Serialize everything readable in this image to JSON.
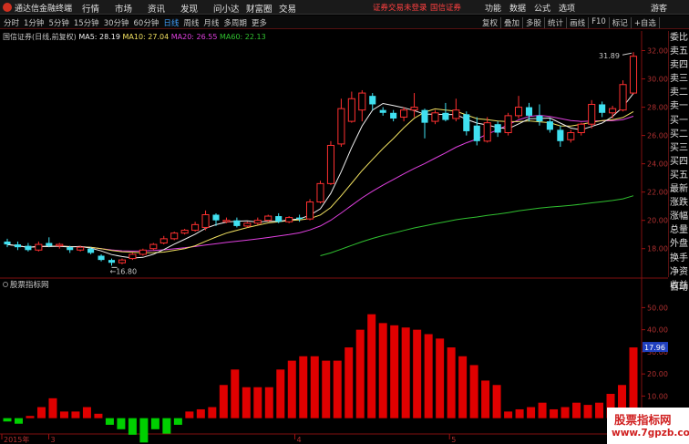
{
  "titlebar": {
    "app_name": "通达信金融终端",
    "menu": [
      "行情",
      "市场",
      "资讯",
      "发现",
      "问小达",
      "财富圈",
      "交易"
    ],
    "alert": "证券交易未登录",
    "broker": "国信证券",
    "right_menu": [
      "功能",
      "数据",
      "公式",
      "选项"
    ],
    "guest": "游客"
  },
  "toolbar": {
    "periods": [
      "分时",
      "1分钟",
      "5分钟",
      "15分钟",
      "30分钟",
      "60分钟",
      "日线",
      "周线",
      "月线",
      "多周期",
      "更多"
    ],
    "active_period": "日线",
    "tools": [
      "复权",
      "叠加",
      "多股",
      "统计",
      "画线",
      "F10",
      "标记",
      "+自选"
    ]
  },
  "info": {
    "stock": "国信证券(日线,前复权)",
    "ma5_label": "MA5: 28.19",
    "ma10_label": "MA10: 27.04",
    "ma20_label": "MA20: 26.55",
    "ma60_label": "MA60: 22.13"
  },
  "colors": {
    "up": "#ff3030",
    "down": "#40e0f0",
    "ma5": "#f0f0f0",
    "ma10": "#f0e060",
    "ma20": "#e040e0",
    "ma60": "#30c030",
    "bar_up": "#e00000",
    "bar_down": "#00d000",
    "value_box": "#2040c0"
  },
  "side_panel": [
    "委比",
    "卖五",
    "卖四",
    "卖三",
    "卖二",
    "卖一",
    "买一",
    "买二",
    "买三",
    "买四",
    "买五",
    "最新",
    "涨跌",
    "涨幅",
    "总量",
    "外盘",
    "换手",
    "净资",
    "收益"
  ],
  "dongli_label": "自动",
  "indicator_label": "股票指标网",
  "watermark": {
    "title": "股票指标网",
    "url": "www.7gpzb.com"
  },
  "chart_data": [
    {
      "type": "candlestick",
      "title": "国信证券(日线,前复权)",
      "ylim": [
        16.5,
        33
      ],
      "y_ticks": [
        18.0,
        20.0,
        22.0,
        24.0,
        26.0,
        28.0,
        30.0,
        32.0
      ],
      "annotations": {
        "high": "31.89",
        "low": "16.80"
      },
      "candles": [
        {
          "o": 18.5,
          "c": 18.3,
          "h": 18.7,
          "l": 18.1
        },
        {
          "o": 18.3,
          "c": 18.1,
          "h": 18.5,
          "l": 17.9
        },
        {
          "o": 18.2,
          "c": 17.9,
          "h": 18.4,
          "l": 17.8
        },
        {
          "o": 17.9,
          "c": 18.3,
          "h": 18.5,
          "l": 17.8
        },
        {
          "o": 18.4,
          "c": 18.2,
          "h": 18.8,
          "l": 18.1
        },
        {
          "o": 18.2,
          "c": 18.3,
          "h": 18.4,
          "l": 18.0
        },
        {
          "o": 18.1,
          "c": 17.9,
          "h": 18.2,
          "l": 17.7
        },
        {
          "o": 17.9,
          "c": 18.1,
          "h": 18.2,
          "l": 17.8
        },
        {
          "o": 18.0,
          "c": 17.7,
          "h": 18.1,
          "l": 17.6
        },
        {
          "o": 17.5,
          "c": 17.2,
          "h": 17.6,
          "l": 17.1
        },
        {
          "o": 17.2,
          "c": 17.0,
          "h": 17.3,
          "l": 16.8
        },
        {
          "o": 17.0,
          "c": 17.2,
          "h": 17.3,
          "l": 16.9
        },
        {
          "o": 17.3,
          "c": 17.6,
          "h": 17.7,
          "l": 17.2
        },
        {
          "o": 17.6,
          "c": 17.9,
          "h": 18.0,
          "l": 17.5
        },
        {
          "o": 18.0,
          "c": 18.3,
          "h": 18.4,
          "l": 17.9
        },
        {
          "o": 18.4,
          "c": 18.7,
          "h": 18.9,
          "l": 18.3
        },
        {
          "o": 18.7,
          "c": 19.1,
          "h": 19.2,
          "l": 18.6
        },
        {
          "o": 19.1,
          "c": 19.3,
          "h": 19.4,
          "l": 19.0
        },
        {
          "o": 19.3,
          "c": 19.7,
          "h": 19.9,
          "l": 19.2
        },
        {
          "o": 19.5,
          "c": 20.4,
          "h": 20.7,
          "l": 19.3
        },
        {
          "o": 20.4,
          "c": 20.0,
          "h": 20.5,
          "l": 19.6
        },
        {
          "o": 19.9,
          "c": 20.0,
          "h": 20.2,
          "l": 19.8
        },
        {
          "o": 20.0,
          "c": 19.6,
          "h": 20.2,
          "l": 19.5
        },
        {
          "o": 19.6,
          "c": 19.8,
          "h": 19.9,
          "l": 19.5
        },
        {
          "o": 19.8,
          "c": 20.0,
          "h": 20.2,
          "l": 19.7
        },
        {
          "o": 20.0,
          "c": 20.3,
          "h": 20.4,
          "l": 19.9
        },
        {
          "o": 20.3,
          "c": 19.9,
          "h": 20.5,
          "l": 19.8
        },
        {
          "o": 19.9,
          "c": 20.2,
          "h": 20.3,
          "l": 19.8
        },
        {
          "o": 20.2,
          "c": 20.1,
          "h": 20.4,
          "l": 19.9
        },
        {
          "o": 20.1,
          "c": 21.3,
          "h": 21.5,
          "l": 20.0
        },
        {
          "o": 21.3,
          "c": 22.6,
          "h": 22.8,
          "l": 21.2
        },
        {
          "o": 22.6,
          "c": 25.3,
          "h": 25.6,
          "l": 22.5
        },
        {
          "o": 25.4,
          "c": 27.9,
          "h": 28.6,
          "l": 25.2
        },
        {
          "o": 27.0,
          "c": 28.6,
          "h": 29.1,
          "l": 26.9
        },
        {
          "o": 27.8,
          "c": 29.0,
          "h": 29.2,
          "l": 27.0
        },
        {
          "o": 28.8,
          "c": 28.2,
          "h": 29.0,
          "l": 27.8
        },
        {
          "o": 27.8,
          "c": 27.6,
          "h": 28.0,
          "l": 27.4
        },
        {
          "o": 27.6,
          "c": 27.2,
          "h": 27.8,
          "l": 27.0
        },
        {
          "o": 27.3,
          "c": 27.8,
          "h": 28.0,
          "l": 27.0
        },
        {
          "o": 27.8,
          "c": 28.0,
          "h": 29.0,
          "l": 27.3
        },
        {
          "o": 27.8,
          "c": 26.9,
          "h": 27.9,
          "l": 25.8
        },
        {
          "o": 27.0,
          "c": 27.6,
          "h": 27.8,
          "l": 26.8
        },
        {
          "o": 27.6,
          "c": 27.1,
          "h": 28.3,
          "l": 27.0
        },
        {
          "o": 27.2,
          "c": 27.8,
          "h": 28.6,
          "l": 27.0
        },
        {
          "o": 27.5,
          "c": 26.3,
          "h": 27.7,
          "l": 26.0
        },
        {
          "o": 26.7,
          "c": 25.6,
          "h": 27.3,
          "l": 25.3
        },
        {
          "o": 25.6,
          "c": 26.9,
          "h": 27.3,
          "l": 25.5
        },
        {
          "o": 26.8,
          "c": 26.2,
          "h": 27.0,
          "l": 25.9
        },
        {
          "o": 26.2,
          "c": 27.4,
          "h": 27.6,
          "l": 26.0
        },
        {
          "o": 27.4,
          "c": 28.0,
          "h": 28.8,
          "l": 27.2
        },
        {
          "o": 28.0,
          "c": 27.4,
          "h": 28.3,
          "l": 27.0
        },
        {
          "o": 27.4,
          "c": 27.0,
          "h": 28.2,
          "l": 26.7
        },
        {
          "o": 27.0,
          "c": 26.4,
          "h": 27.2,
          "l": 26.2
        },
        {
          "o": 26.4,
          "c": 25.6,
          "h": 26.7,
          "l": 25.2
        },
        {
          "o": 25.7,
          "c": 26.2,
          "h": 26.4,
          "l": 25.5
        },
        {
          "o": 26.2,
          "c": 26.8,
          "h": 26.9,
          "l": 26.0
        },
        {
          "o": 26.8,
          "c": 28.2,
          "h": 28.5,
          "l": 26.5
        },
        {
          "o": 28.2,
          "c": 27.6,
          "h": 28.4,
          "l": 27.3
        },
        {
          "o": 27.6,
          "c": 27.9,
          "h": 28.1,
          "l": 27.2
        },
        {
          "o": 27.8,
          "c": 29.6,
          "h": 29.9,
          "l": 27.7
        },
        {
          "o": 29.0,
          "c": 31.6,
          "h": 31.89,
          "l": 28.9
        }
      ]
    },
    {
      "type": "bar",
      "title": "股票指标网",
      "ylim": [
        -5.5,
        58
      ],
      "y_ticks": [
        0.0,
        10.0,
        20.0,
        30.0,
        40.0,
        50.0
      ],
      "last_value": "17.96",
      "x_tick_labels": [
        "2015年",
        "3",
        "4",
        "5"
      ],
      "values": [
        -1.5,
        -2.5,
        1,
        5,
        9,
        3,
        3,
        5,
        2,
        -3,
        -5,
        -7.5,
        -11,
        -5,
        -7,
        -3,
        3,
        4,
        5,
        15,
        22,
        14,
        14,
        14,
        22,
        26,
        28,
        28,
        26,
        26,
        32,
        40,
        47,
        43,
        42,
        41,
        40,
        38,
        36,
        32,
        28,
        24,
        17,
        15,
        3,
        4,
        5,
        7,
        4,
        5,
        7,
        6,
        7,
        11,
        15,
        32
      ]
    }
  ]
}
